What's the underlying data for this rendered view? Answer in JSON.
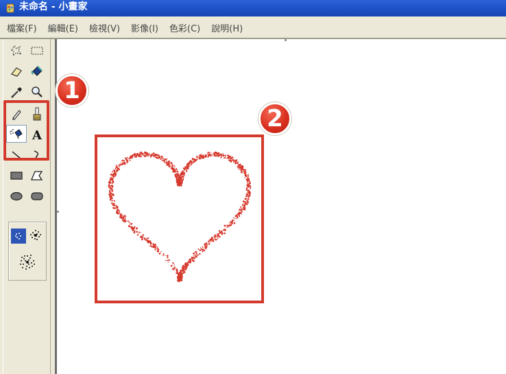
{
  "window": {
    "title": "未命名 - 小畫家",
    "icon": "paint-app-icon"
  },
  "menu": [
    {
      "label": "檔案(F)"
    },
    {
      "label": "編輯(E)"
    },
    {
      "label": "檢視(V)"
    },
    {
      "label": "影像(I)"
    },
    {
      "label": "色彩(C)"
    },
    {
      "label": "說明(H)"
    }
  ],
  "toolbox": {
    "tools": [
      {
        "name": "free-form-select-icon"
      },
      {
        "name": "rectangle-select-icon"
      },
      {
        "name": "eraser-icon"
      },
      {
        "name": "fill-bucket-icon"
      },
      {
        "name": "pick-color-icon"
      },
      {
        "name": "magnifier-icon"
      },
      {
        "name": "pencil-icon"
      },
      {
        "name": "brush-icon"
      },
      {
        "name": "airbrush-icon",
        "selected": true
      },
      {
        "name": "text-icon",
        "glyph": "A"
      },
      {
        "name": "line-icon"
      },
      {
        "name": "curve-icon"
      },
      {
        "name": "rectangle-icon"
      },
      {
        "name": "polygon-icon"
      },
      {
        "name": "ellipse-icon"
      },
      {
        "name": "rounded-rectangle-icon"
      }
    ],
    "airbrush_sizes": [
      "small",
      "medium",
      "large"
    ],
    "selected_airbrush_size": "small"
  },
  "annotations": {
    "badge_1": "1",
    "badge_2": "2",
    "marker_color": "#d33a2c"
  },
  "canvas": {
    "drawing": "heart",
    "stroke_color": "#d63a2f"
  }
}
